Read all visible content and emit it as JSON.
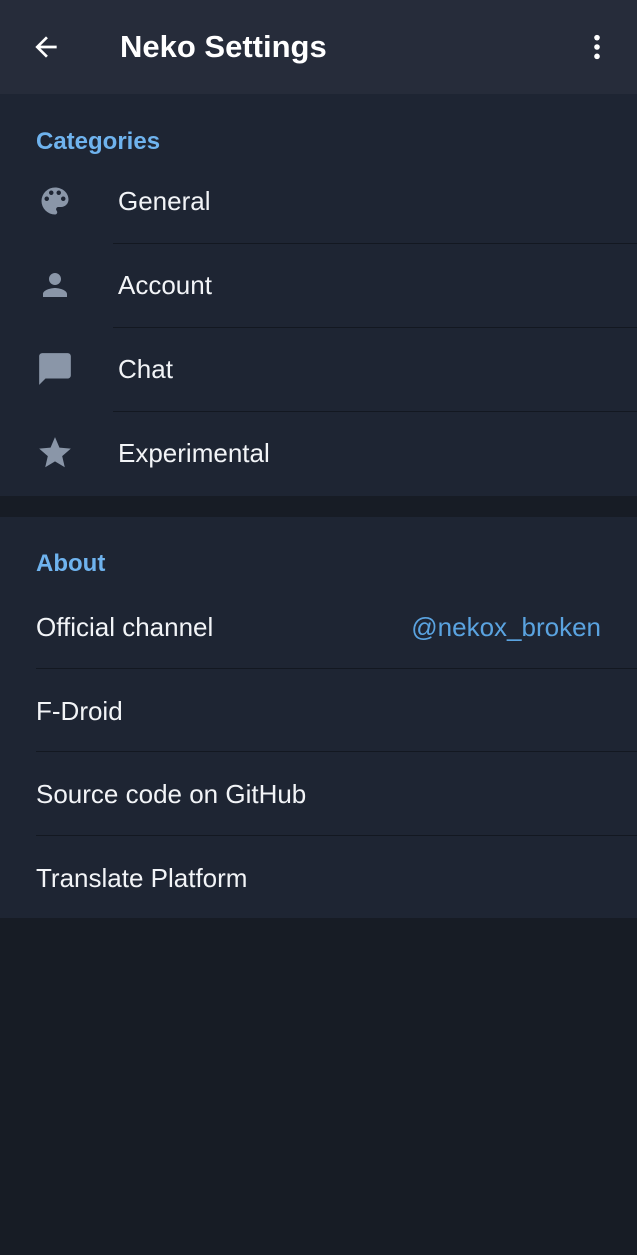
{
  "appbar": {
    "title": "Neko Settings",
    "back_icon": "arrow-back-icon",
    "menu_icon": "more-vert-icon"
  },
  "categories": {
    "header": "Categories",
    "items": [
      {
        "label": "General",
        "icon": "palette-icon"
      },
      {
        "label": "Account",
        "icon": "person-icon"
      },
      {
        "label": "Chat",
        "icon": "chat-bubble-icon"
      },
      {
        "label": "Experimental",
        "icon": "star-icon"
      }
    ]
  },
  "about": {
    "header": "About",
    "items": [
      {
        "label": "Official channel",
        "value": "@nekox_broken"
      },
      {
        "label": "F-Droid"
      },
      {
        "label": "Source code on GitHub"
      },
      {
        "label": "Translate Platform"
      }
    ]
  },
  "colors": {
    "background": "#171c25",
    "appbar": "#262c3a",
    "section": "#1e2533",
    "accent": "#6fb3ee",
    "link": "#5aa3e0",
    "icon": "#8a96a8",
    "text": "#f2f4f7"
  }
}
